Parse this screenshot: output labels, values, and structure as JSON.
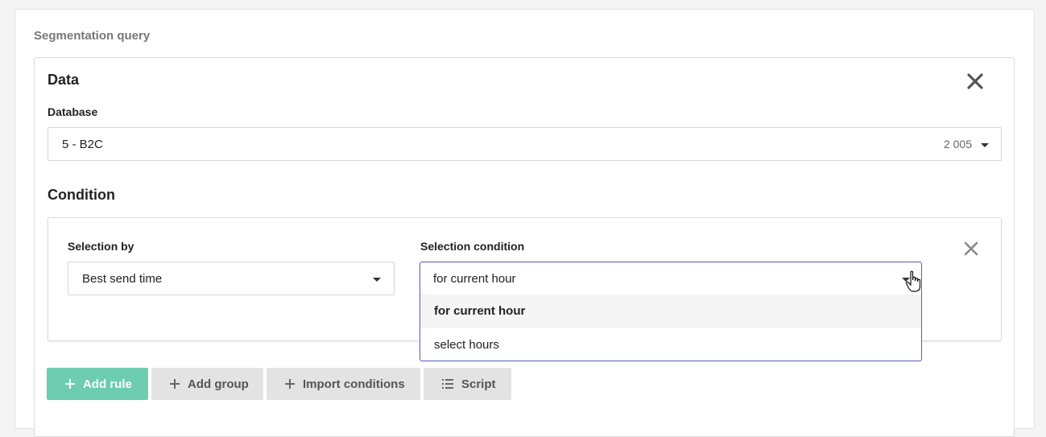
{
  "section_title": "Segmentation query",
  "data_panel": {
    "title": "Data",
    "database_label": "Database",
    "database_value": "5 - B2C",
    "database_count": "2 005"
  },
  "condition": {
    "title": "Condition",
    "selection_by_label": "Selection by",
    "selection_by_value": "Best send time",
    "selection_condition_label": "Selection condition",
    "selection_condition_value": "for current hour",
    "options": [
      "for current hour",
      "select hours"
    ]
  },
  "buttons": {
    "add_rule": "Add rule",
    "add_group": "Add group",
    "import_conditions": "Import conditions",
    "script": "Script"
  },
  "colors": {
    "primary": "#6dcdae",
    "dropdown_border": "#4a5fc1",
    "secondary_button": "#e3e3e3"
  }
}
